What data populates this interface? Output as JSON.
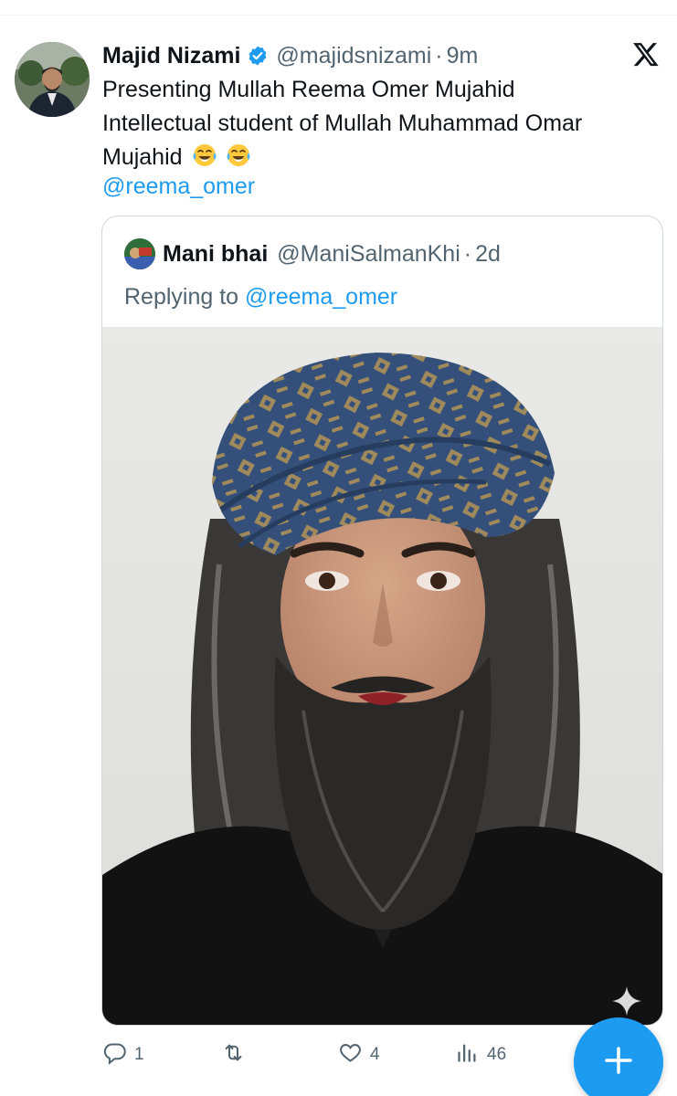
{
  "tweet": {
    "author_name": "Majid Nizami",
    "handle": "@majidsnizami",
    "separator": "·",
    "time": "9m",
    "text_lines": [
      "Presenting Mullah Reema Omer Mujahid",
      "Intellectual student of Mullah Muhammad Omar",
      "Mujahid"
    ],
    "emoji": [
      "😂",
      "😂"
    ],
    "mention": "@reema_omer",
    "icons": {
      "verified": "verified-badge-icon",
      "platform": "x-logo-icon",
      "emoji": "face-with-tears-of-joy-icon"
    }
  },
  "quote": {
    "author_name": "Mani bhai",
    "handle": "@ManiSalmanKhi",
    "separator": "·",
    "time": "2d",
    "replying_prefix": "Replying to",
    "replying_mention": "@reema_omer",
    "image_subject": "portrait-photo"
  },
  "actions": {
    "reply_count": "1",
    "retweet_count": "",
    "like_count": "4",
    "views_count": "46",
    "icons": [
      "reply-icon",
      "retweet-icon",
      "like-icon",
      "views-icon"
    ]
  },
  "fab": {
    "icon": "plus-icon"
  },
  "colors": {
    "accent": "#1d9bf0",
    "text_primary": "#0f1419",
    "text_secondary": "#536471",
    "border": "#cfd9de"
  }
}
